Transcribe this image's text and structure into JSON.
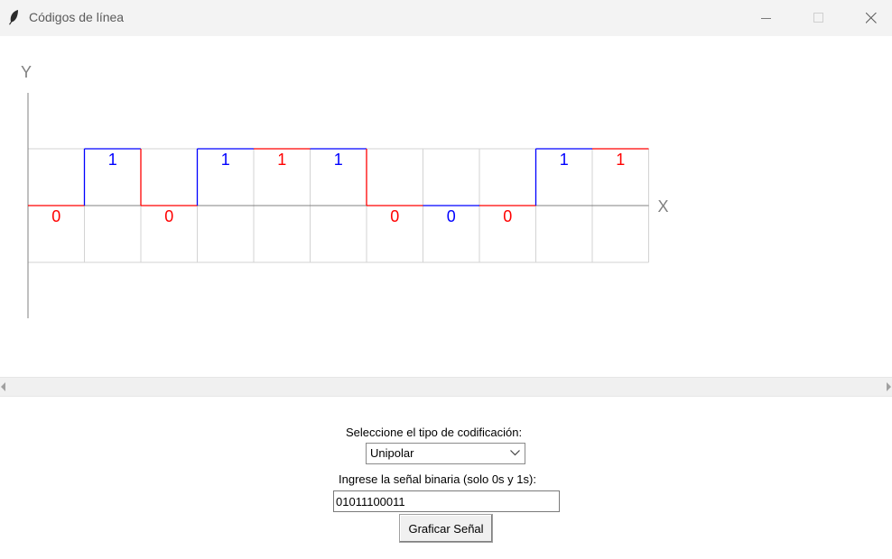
{
  "window": {
    "title": "Códigos de línea",
    "icon": "feather-icon",
    "buttons": [
      "minimize-icon",
      "maximize-icon",
      "close-icon"
    ]
  },
  "chart_data": {
    "type": "line",
    "encoding": "Unipolar",
    "bits": [
      0,
      1,
      0,
      1,
      1,
      1,
      0,
      0,
      0,
      1,
      1
    ],
    "bit_labels": [
      "0",
      "1",
      "0",
      "1",
      "1",
      "1",
      "0",
      "0",
      "0",
      "1",
      "1"
    ],
    "bit_colors": [
      "#ff0000",
      "#0000ff",
      "#ff0000",
      "#0000ff",
      "#ff0000",
      "#0000ff",
      "#ff0000",
      "#0000ff",
      "#ff0000",
      "#0000ff",
      "#ff0000"
    ],
    "xlabel": "X",
    "ylabel": "Y",
    "ylim": [
      -1,
      1
    ],
    "grid": true,
    "axis_color": "#808080",
    "grid_color": "#d3d3d3"
  },
  "controls": {
    "encoding_label": "Seleccione el tipo de codificación:",
    "encoding_value": "Unipolar",
    "signal_label": "Ingrese la señal binaria (solo 0s y 1s):",
    "signal_value": "01011100011",
    "plot_button": "Graficar Señal"
  }
}
